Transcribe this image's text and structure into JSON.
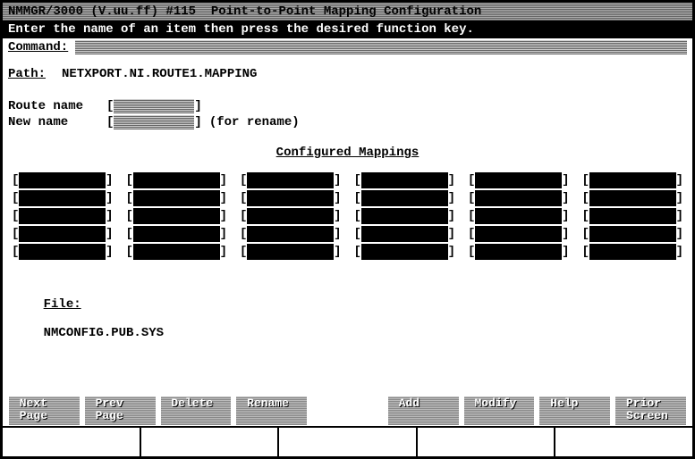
{
  "header": "NMMGR/3000 (V.uu.ff) #115  Point-to-Point Mapping Configuration",
  "instruction": "Enter the name of an item then press the desired function key.",
  "command_label": "Command:",
  "path_label": "Path:",
  "path_value": "NETXPORT.NI.ROUTE1.MAPPING",
  "route_label": "Route name",
  "new_label": "New name",
  "rename_hint": "(for rename)",
  "section_heading": "Configured Mappings",
  "file_label": "File:",
  "file_value": "NMCONFIG.PUB.SYS",
  "fkeys": [
    {
      "l1": "Next",
      "l2": "Page"
    },
    {
      "l1": "Prev",
      "l2": "Page"
    },
    {
      "l1": "Delete",
      "l2": ""
    },
    {
      "l1": "Rename",
      "l2": ""
    },
    {
      "blank": true
    },
    {
      "l1": "Add",
      "l2": ""
    },
    {
      "l1": "Modify",
      "l2": ""
    },
    {
      "l1": "Help",
      "l2": ""
    },
    {
      "l1": "Prior",
      "l2": "Screen"
    }
  ],
  "slot_cols": 6,
  "slot_rows": 5
}
